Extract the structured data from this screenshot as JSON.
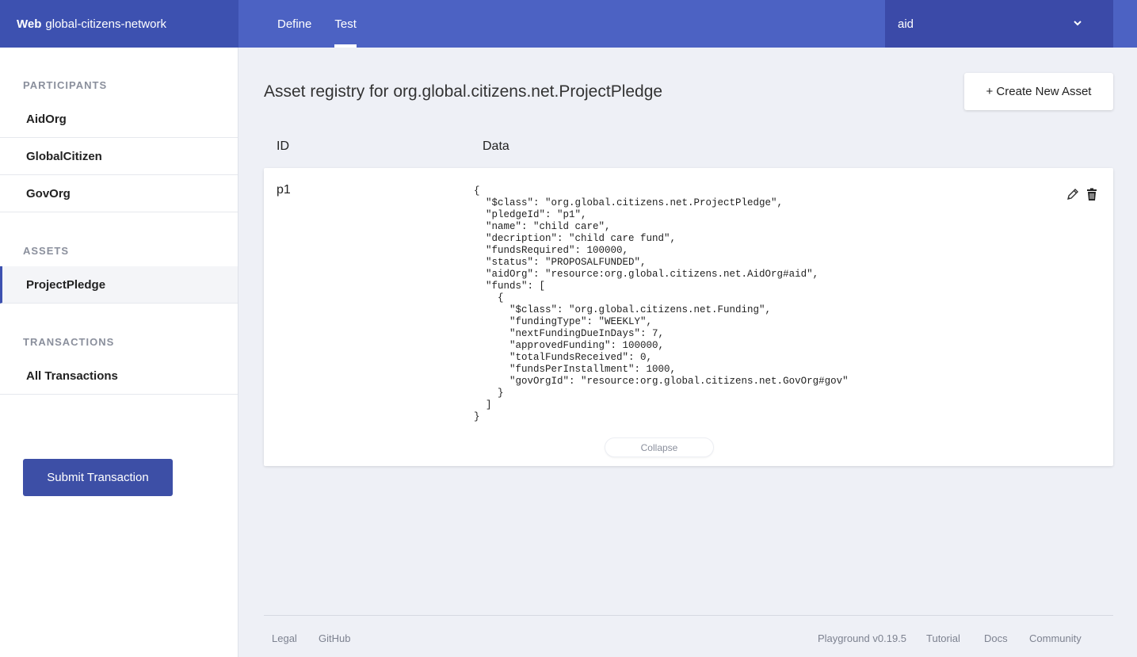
{
  "topbar": {
    "brand_strong": "Web",
    "brand_name": "global-citizens-network",
    "tabs": [
      {
        "label": "Define",
        "active": false
      },
      {
        "label": "Test",
        "active": true
      }
    ],
    "identity": "aid",
    "chevron_icon": "chevron-down-icon"
  },
  "sidebar": {
    "participants_title": "PARTICIPANTS",
    "participants": [
      "AidOrg",
      "GlobalCitizen",
      "GovOrg"
    ],
    "assets_title": "ASSETS",
    "assets": [
      "ProjectPledge"
    ],
    "transactions_title": "TRANSACTIONS",
    "transactions": [
      "All Transactions"
    ],
    "submit_label": "Submit Transaction"
  },
  "main": {
    "title": "Asset registry for org.global.citizens.net.ProjectPledge",
    "create_label": "+ Create New Asset",
    "col_id": "ID",
    "col_data": "Data",
    "row": {
      "id": "p1",
      "json": "{\n  \"$class\": \"org.global.citizens.net.ProjectPledge\",\n  \"pledgeId\": \"p1\",\n  \"name\": \"child care\",\n  \"decription\": \"child care fund\",\n  \"fundsRequired\": 100000,\n  \"status\": \"PROPOSALFUNDED\",\n  \"aidOrg\": \"resource:org.global.citizens.net.AidOrg#aid\",\n  \"funds\": [\n    {\n      \"$class\": \"org.global.citizens.net.Funding\",\n      \"fundingType\": \"WEEKLY\",\n      \"nextFundingDueInDays\": 7,\n      \"approvedFunding\": 100000,\n      \"totalFundsReceived\": 0,\n      \"fundsPerInstallment\": 1000,\n      \"govOrgId\": \"resource:org.global.citizens.net.GovOrg#gov\"\n    }\n  ]\n}",
      "edit_icon": "pencil-icon",
      "delete_icon": "trash-icon",
      "collapse_label": "Collapse"
    }
  },
  "footer": {
    "left": [
      "Legal",
      "GitHub"
    ],
    "right": [
      "Playground v0.19.5",
      "Tutorial",
      "Docs",
      "Community"
    ]
  },
  "colors": {
    "topbar": "#4c62c3",
    "brand": "#3d51b0",
    "identity": "#3b4aa8",
    "accent": "#3d4fa6"
  }
}
